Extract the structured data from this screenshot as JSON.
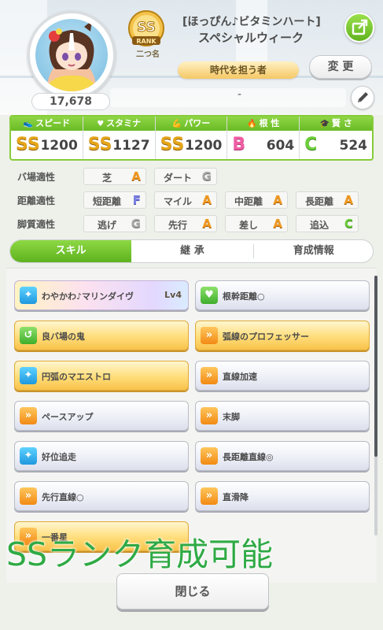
{
  "profile": {
    "fan_count": "17,678",
    "rank": "SS",
    "rank_word": "RANK",
    "rank_sub": "二つ名",
    "title": "[ほっぴん♪ビタミンハート]",
    "name": "スペシャルウィーク",
    "epithet": "時代を担う者",
    "memo": "-",
    "change_label": "変 更"
  },
  "stats": [
    {
      "label": "スピード",
      "icon": "shoe-icon",
      "grade": "SS",
      "value": "1200"
    },
    {
      "label": "スタミナ",
      "icon": "heart-icon",
      "grade": "SS",
      "value": "1127"
    },
    {
      "label": "パワー",
      "icon": "arm-icon",
      "grade": "SS",
      "value": "1200"
    },
    {
      "label": "根 性",
      "icon": "flame-icon",
      "grade": "B",
      "value": "604"
    },
    {
      "label": "賢 さ",
      "icon": "grad-cap-icon",
      "grade": "C",
      "value": "524"
    }
  ],
  "aptitude": {
    "track": {
      "label": "バ場適性",
      "items": [
        {
          "name": "芝",
          "grade": "A"
        },
        {
          "name": "ダート",
          "grade": "G"
        }
      ]
    },
    "distance": {
      "label": "距離適性",
      "items": [
        {
          "name": "短距離",
          "grade": "F"
        },
        {
          "name": "マイル",
          "grade": "A"
        },
        {
          "name": "中距離",
          "grade": "A"
        },
        {
          "name": "長距離",
          "grade": "A"
        }
      ]
    },
    "style": {
      "label": "脚質適性",
      "items": [
        {
          "name": "逃げ",
          "grade": "G"
        },
        {
          "name": "先行",
          "grade": "A"
        },
        {
          "name": "差し",
          "grade": "A"
        },
        {
          "name": "追込",
          "grade": "C"
        }
      ]
    }
  },
  "tabs": [
    "スキル",
    "継 承",
    "育成情報"
  ],
  "skills": [
    {
      "name": "わやかわ♪マリンダイヴ",
      "level": "Lv4",
      "style": "unique",
      "icon": "sparkle-icon"
    },
    {
      "name": "根幹距離○",
      "level": "",
      "style": "normal",
      "icon": "heart-icon"
    },
    {
      "name": "良バ場の鬼",
      "level": "",
      "style": "gold",
      "icon": "recovery-icon"
    },
    {
      "name": "弧線のプロフェッサー",
      "level": "",
      "style": "gold",
      "icon": "speed-icon"
    },
    {
      "name": "円弧のマエストロ",
      "level": "",
      "style": "gold",
      "icon": "sparkle-icon"
    },
    {
      "name": "直線加速",
      "level": "",
      "style": "normal",
      "icon": "speed-icon"
    },
    {
      "name": "ペースアップ",
      "level": "",
      "style": "normal",
      "icon": "speed-icon"
    },
    {
      "name": "末脚",
      "level": "",
      "style": "normal",
      "icon": "speed-icon"
    },
    {
      "name": "好位追走",
      "level": "",
      "style": "normal",
      "icon": "sparkle-icon"
    },
    {
      "name": "長距離直線◎",
      "level": "",
      "style": "normal",
      "icon": "speed-icon"
    },
    {
      "name": "先行直線○",
      "level": "",
      "style": "normal",
      "icon": "speed-icon"
    },
    {
      "name": "直滑降",
      "level": "",
      "style": "normal",
      "icon": "speed-icon"
    },
    {
      "name": "一番星",
      "level": "",
      "style": "gold",
      "icon": "speed-icon"
    }
  ],
  "close_label": "閉じる",
  "overlay_caption": "SSランク育成可能",
  "colors": {
    "accent_green": "#6cbf2b",
    "caption_green": "#2faa45",
    "gold": "#f8c24a"
  }
}
